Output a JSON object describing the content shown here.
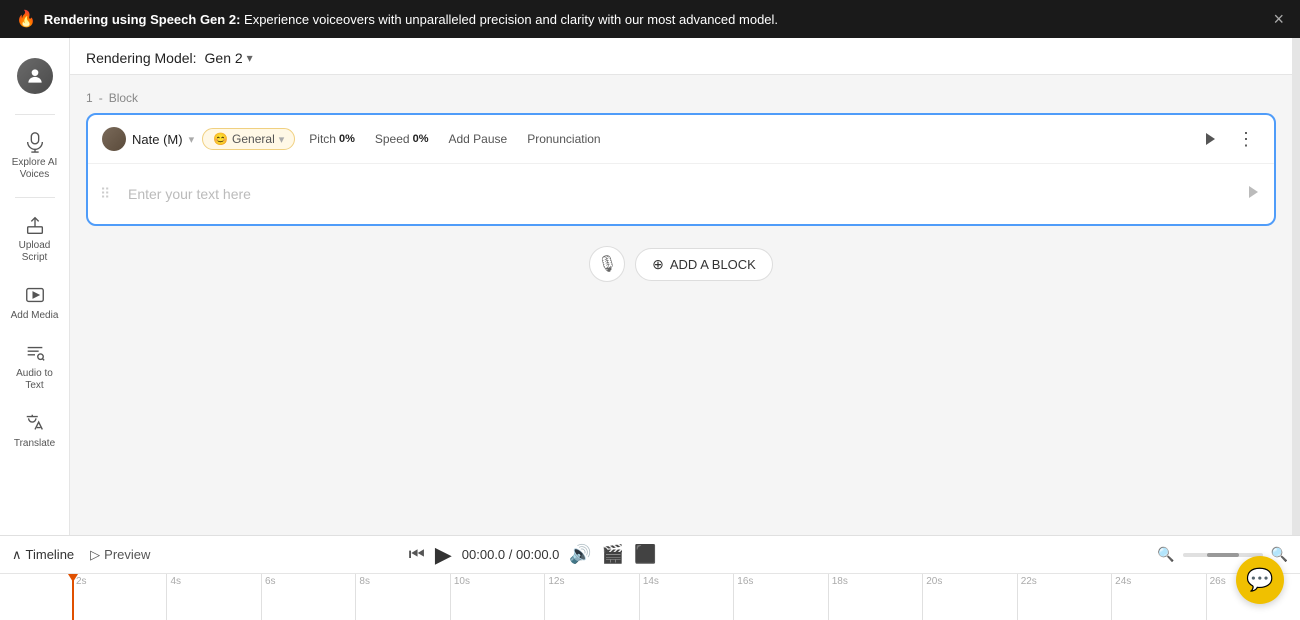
{
  "banner": {
    "icon": "🔥",
    "text_bold": "Rendering using Speech Gen 2:",
    "text_normal": " Experience voiceovers with unparalleled precision and clarity with our most advanced model.",
    "close_label": "×"
  },
  "sidebar": {
    "avatar_label": "User Avatar",
    "items": [
      {
        "id": "explore-ai",
        "label": "Explore AI Voices",
        "icon": "explore"
      },
      {
        "id": "upload-script",
        "label": "Upload Script",
        "icon": "upload"
      },
      {
        "id": "add-media",
        "label": "Add Media",
        "icon": "media"
      },
      {
        "id": "audio-to-text",
        "label": "Audio to Text",
        "icon": "audio"
      },
      {
        "id": "translate",
        "label": "Translate",
        "icon": "translate"
      }
    ]
  },
  "header": {
    "rendering_label": "Rendering Model:",
    "rendering_model": "Gen 2",
    "dropdown_icon": "▾"
  },
  "block": {
    "number": "1",
    "label": "Block",
    "voice_name": "Nate (M)",
    "mood_emoji": "😊",
    "mood_label": "General",
    "pitch_label": "Pitch",
    "pitch_value": "0%",
    "speed_label": "Speed",
    "speed_value": "0%",
    "add_pause_label": "Add Pause",
    "pronunciation_label": "Pronunciation",
    "text_placeholder": "Enter your text here"
  },
  "add_block": {
    "label": "ADD A BLOCK"
  },
  "timeline": {
    "toggle_label": "Timeline",
    "preview_label": "Preview",
    "time_current": "00:00.0",
    "time_total": "00:00.0",
    "ticks": [
      "2s",
      "4s",
      "6s",
      "8s",
      "10s",
      "12s",
      "14s",
      "16s",
      "18s",
      "20s",
      "22s",
      "24s",
      "26s"
    ]
  },
  "chat_fab": {
    "icon": "💬"
  }
}
